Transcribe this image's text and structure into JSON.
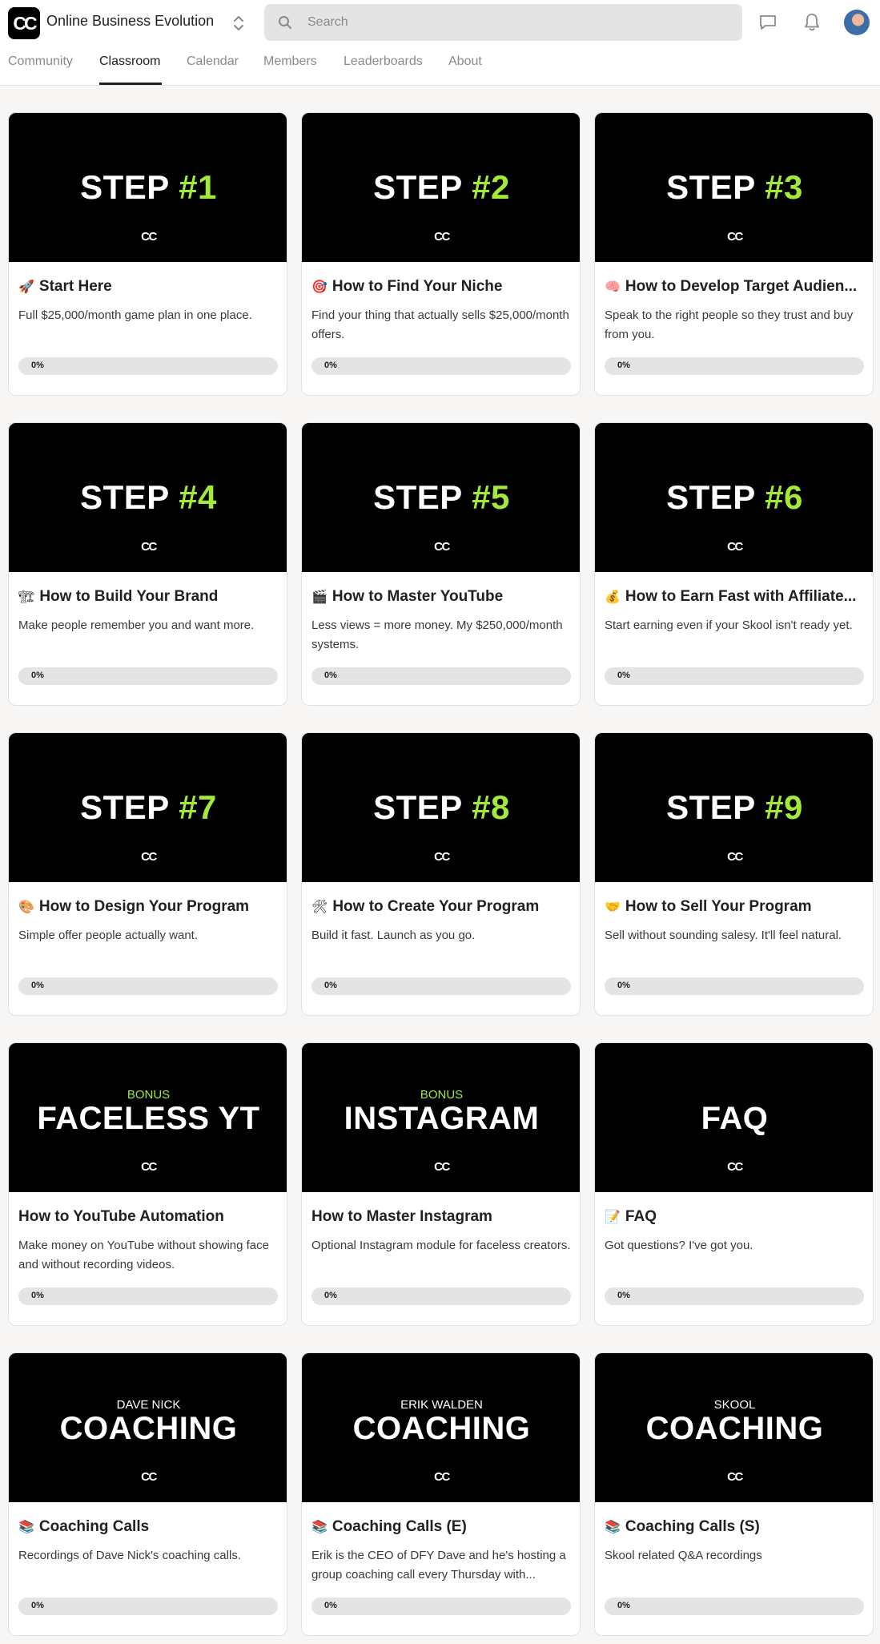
{
  "header": {
    "logo_text": "CC",
    "community_name": "Online Business Evolution",
    "search_placeholder": "Search",
    "icons": [
      "switcher-chevron-icon",
      "search-icon",
      "chat-icon",
      "bell-icon",
      "avatar"
    ]
  },
  "tabs": [
    {
      "label": "Community",
      "active": false
    },
    {
      "label": "Classroom",
      "active": true
    },
    {
      "label": "Calendar",
      "active": false
    },
    {
      "label": "Members",
      "active": false
    },
    {
      "label": "Leaderboards",
      "active": false
    },
    {
      "label": "About",
      "active": false
    }
  ],
  "colors": {
    "accent": "#a3ea38",
    "cover_bg": "#000000",
    "page_bg": "#f7f6f4"
  },
  "courses": [
    {
      "cover": {
        "kind": "step",
        "text": "STEP ",
        "num": "#1"
      },
      "cover_mark": "CC",
      "emoji": "🚀",
      "title": "Start Here",
      "desc": "Full $25,000/month game plan in one place.",
      "progress": 0,
      "progress_label": "0%"
    },
    {
      "cover": {
        "kind": "step",
        "text": "STEP ",
        "num": "#2"
      },
      "cover_mark": "CC",
      "emoji": "🎯",
      "title": "How to Find Your Niche",
      "desc": "Find your thing that actually sells $25,000/month offers.",
      "progress": 0,
      "progress_label": "0%"
    },
    {
      "cover": {
        "kind": "step",
        "text": "STEP ",
        "num": "#3"
      },
      "cover_mark": "CC",
      "emoji": "🧠",
      "title": "How to Develop Target Audien...",
      "desc": "Speak to the right people so they trust and buy from you.",
      "progress": 0,
      "progress_label": "0%"
    },
    {
      "cover": {
        "kind": "step",
        "text": "STEP ",
        "num": "#4"
      },
      "cover_mark": "CC",
      "emoji": "🏗",
      "title": "How to Build Your Brand",
      "desc": "Make people remember you and want more.",
      "progress": 0,
      "progress_label": "0%"
    },
    {
      "cover": {
        "kind": "step",
        "text": "STEP ",
        "num": "#5"
      },
      "cover_mark": "CC",
      "emoji": "🎬",
      "title": "How to Master YouTube",
      "desc": "Less views = more money. My $250,000/month systems.",
      "progress": 0,
      "progress_label": "0%"
    },
    {
      "cover": {
        "kind": "step",
        "text": "STEP ",
        "num": "#6"
      },
      "cover_mark": "CC",
      "emoji": "💰",
      "title": "How to Earn Fast with Affiliate...",
      "desc": "Start earning even if your Skool isn't ready yet.",
      "progress": 0,
      "progress_label": "0%"
    },
    {
      "cover": {
        "kind": "step",
        "text": "STEP ",
        "num": "#7"
      },
      "cover_mark": "CC",
      "emoji": "🎨",
      "title": "How to Design Your Program",
      "desc": "Simple offer people actually want.",
      "progress": 0,
      "progress_label": "0%"
    },
    {
      "cover": {
        "kind": "step",
        "text": "STEP ",
        "num": "#8"
      },
      "cover_mark": "CC",
      "emoji": "🛠",
      "title": "How to Create Your Program",
      "desc": "Build it fast. Launch as you go.",
      "progress": 0,
      "progress_label": "0%"
    },
    {
      "cover": {
        "kind": "step",
        "text": "STEP ",
        "num": "#9"
      },
      "cover_mark": "CC",
      "emoji": "🤝",
      "title": "How to Sell Your Program",
      "desc": "Sell without sounding salesy. It'll feel natural.",
      "progress": 0,
      "progress_label": "0%"
    },
    {
      "cover": {
        "kind": "big",
        "supra": "BONUS",
        "supra_color": "green",
        "big": "FACELESS YT"
      },
      "cover_mark": "CC",
      "emoji": "",
      "title": "How to YouTube Automation",
      "desc": "Make money on YouTube without showing face and without recording videos.",
      "progress": 0,
      "progress_label": "0%"
    },
    {
      "cover": {
        "kind": "big",
        "supra": "BONUS",
        "supra_color": "green",
        "big": "INSTAGRAM"
      },
      "cover_mark": "CC",
      "emoji": "",
      "title": "How to Master Instagram",
      "desc": "Optional Instagram module for faceless creators.",
      "progress": 0,
      "progress_label": "0%"
    },
    {
      "cover": {
        "kind": "big",
        "supra": "",
        "supra_color": "white",
        "big": "FAQ"
      },
      "cover_mark": "CC",
      "emoji": "📝",
      "title": "FAQ",
      "desc": "Got questions? I've got you.",
      "progress": 0,
      "progress_label": "0%"
    },
    {
      "cover": {
        "kind": "big",
        "supra": "DAVE NICK",
        "supra_color": "white",
        "big": "COACHING"
      },
      "cover_mark": "CC",
      "emoji": "📚",
      "title": "Coaching Calls",
      "desc": "Recordings of Dave Nick's coaching calls.",
      "progress": 0,
      "progress_label": "0%"
    },
    {
      "cover": {
        "kind": "big",
        "supra": "ERIK WALDEN",
        "supra_color": "white",
        "big": "COACHING"
      },
      "cover_mark": "CC",
      "emoji": "📚",
      "title": "Coaching Calls (E)",
      "desc": "Erik is the CEO of DFY Dave and he's hosting a group coaching call every Thursday with...",
      "progress": 0,
      "progress_label": "0%"
    },
    {
      "cover": {
        "kind": "big",
        "supra": "SKOOL",
        "supra_color": "white",
        "big": "COACHING"
      },
      "cover_mark": "CC",
      "emoji": "📚",
      "title": "Coaching Calls (S)",
      "desc": "Skool related Q&A recordings",
      "progress": 0,
      "progress_label": "0%"
    }
  ]
}
